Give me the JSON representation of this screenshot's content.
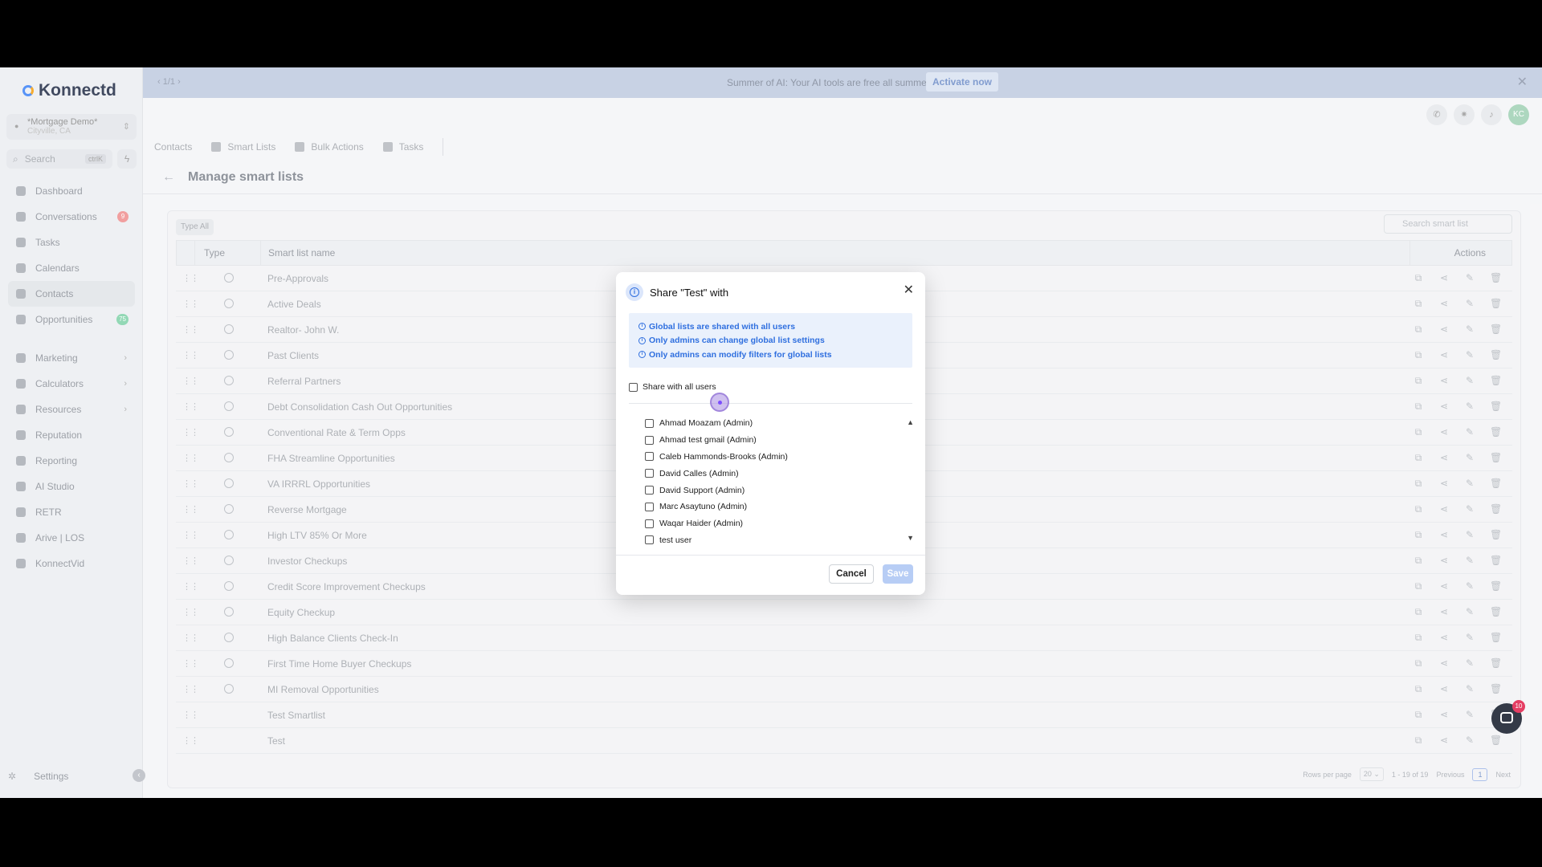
{
  "app": {
    "logo": "Konnectd"
  },
  "account": {
    "name": "*Mortgage Demo*",
    "location": "Cityville, CA"
  },
  "search": {
    "placeholder": "Search",
    "shortcut": "ctrlK"
  },
  "sidebar": {
    "items": [
      {
        "label": "Dashboard",
        "icon": "dashboard-icon"
      },
      {
        "label": "Conversations",
        "icon": "chat-icon",
        "badge": "9"
      },
      {
        "label": "Tasks",
        "icon": "tasks-icon"
      },
      {
        "label": "Calendars",
        "icon": "calendar-icon"
      },
      {
        "label": "Contacts",
        "icon": "contacts-icon",
        "active": true
      },
      {
        "label": "Opportunities",
        "icon": "opportunities-icon",
        "badge": "75"
      }
    ],
    "items2": [
      {
        "label": "Marketing",
        "icon": "marketing-icon",
        "chevron": true
      },
      {
        "label": "Calculators",
        "icon": "calculator-icon",
        "chevron": true
      },
      {
        "label": "Resources",
        "icon": "resources-icon",
        "chevron": true
      },
      {
        "label": "Reputation",
        "icon": "star-icon"
      },
      {
        "label": "Reporting",
        "icon": "reporting-icon"
      },
      {
        "label": "AI Studio",
        "icon": "ai-icon"
      },
      {
        "label": "RETR",
        "icon": "retr-icon"
      },
      {
        "label": "Arive | LOS",
        "icon": "arive-icon"
      },
      {
        "label": "KonnectVid",
        "icon": "video-icon"
      }
    ],
    "settings": "Settings"
  },
  "banner": {
    "pager": "1/1",
    "message": "Summer of AI: Your AI tools are free all summer.",
    "action": "Activate now"
  },
  "header": {
    "avatar": "KC"
  },
  "tabs": {
    "contacts": "Contacts",
    "smart_lists": "Smart Lists",
    "bulk_actions": "Bulk Actions",
    "tasks": "Tasks"
  },
  "page": {
    "title": "Manage smart lists"
  },
  "filters": {
    "type_chip": "Type  All",
    "search_placeholder": "Search smart list"
  },
  "table": {
    "columns": {
      "type": "Type",
      "name": "Smart list name",
      "actions": "Actions"
    },
    "rows": [
      "Pre-Approvals",
      "Active Deals",
      "Realtor- John W.",
      "Past Clients",
      "Referral Partners",
      "Debt Consolidation Cash Out Opportunities",
      "Conventional Rate & Term Opps",
      "FHA Streamline Opportunities",
      "VA IRRRL Opportunities",
      "Reverse Mortgage",
      "High LTV 85% Or More",
      "Investor Checkups",
      "Credit Score Improvement Checkups",
      "Equity Checkup",
      "High Balance Clients Check-In",
      "First Time Home Buyer Checkups",
      "MI Removal Opportunities",
      "Test Smartlist",
      "Test"
    ],
    "global_count": 17
  },
  "pagination": {
    "rows_per_page_label": "Rows per page",
    "rows_per_page": "20",
    "range": "1 - 19 of 19",
    "previous": "Previous",
    "current": "1",
    "next": "Next"
  },
  "chat": {
    "unread": "10"
  },
  "modal": {
    "title": "Share \"Test\" with",
    "notes": [
      "Global lists are shared with all users",
      "Only admins can change global list settings",
      "Only admins can modify filters for global lists"
    ],
    "share_all_label": "Share with all users",
    "share_all_checked": false,
    "users": [
      "Ahmad Moazam (Admin)",
      "Ahmad test gmail (Admin)",
      "Caleb Hammonds-Brooks (Admin)",
      "David Calles (Admin)",
      "David Support (Admin)",
      "Marc Asaytuno (Admin)",
      "Waqar Haider (Admin)",
      "test user"
    ],
    "cancel": "Cancel",
    "save": "Save"
  }
}
